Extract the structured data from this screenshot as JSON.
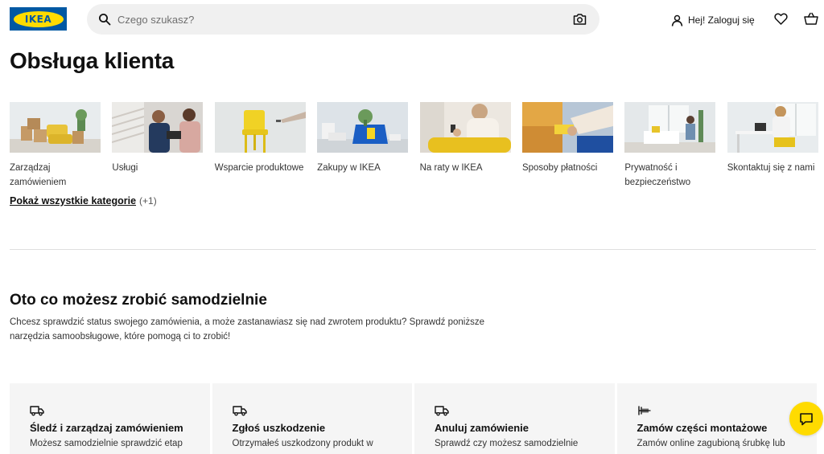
{
  "header": {
    "logo_text": "IKEA",
    "search_placeholder": "Czego szukasz?",
    "login_label": "Hej! Zaloguj się",
    "icons": [
      "search-icon",
      "camera-icon",
      "user-icon",
      "heart-icon",
      "cart-icon"
    ]
  },
  "page_title": "Obsługa klienta",
  "categories": [
    {
      "label": "Zarządzaj zamówieniem"
    },
    {
      "label": "Usługi"
    },
    {
      "label": "Wsparcie produktowe"
    },
    {
      "label": "Zakupy w IKEA"
    },
    {
      "label": "Na raty w IKEA"
    },
    {
      "label": "Sposoby płatności"
    },
    {
      "label": "Prywatność i bezpieczeństwo"
    },
    {
      "label": "Skontaktuj się z nami"
    }
  ],
  "show_all": {
    "label": "Pokaż wszystkie kategorie",
    "count": "(+1)"
  },
  "self_service": {
    "title": "Oto co możesz zrobić samodzielnie",
    "description": "Chcesz sprawdzić status swojego zamówienia, a może zastanawiasz się nad zwrotem produktu? Sprawdź poniższe narzędzia samoobsługowe, które pomogą ci to zrobić!"
  },
  "cards": [
    {
      "icon": "truck-icon",
      "title": "Śledź i zarządzaj zamówieniem",
      "desc": "Możesz samodzielnie sprawdzić etap"
    },
    {
      "icon": "truck-icon",
      "title": "Zgłoś uszkodzenie",
      "desc": "Otrzymałeś uszkodzony produkt w"
    },
    {
      "icon": "truck-icon",
      "title": "Anuluj zamówienie",
      "desc": "Sprawdź czy możesz samodzielnie"
    },
    {
      "icon": "screw-icon",
      "title": "Zamów części montażowe",
      "desc": "Zamów online zagubioną śrubkę lub"
    }
  ],
  "colors": {
    "brand_blue": "#0058a3",
    "brand_yellow": "#ffdb00",
    "card_bg": "#f5f5f5"
  }
}
